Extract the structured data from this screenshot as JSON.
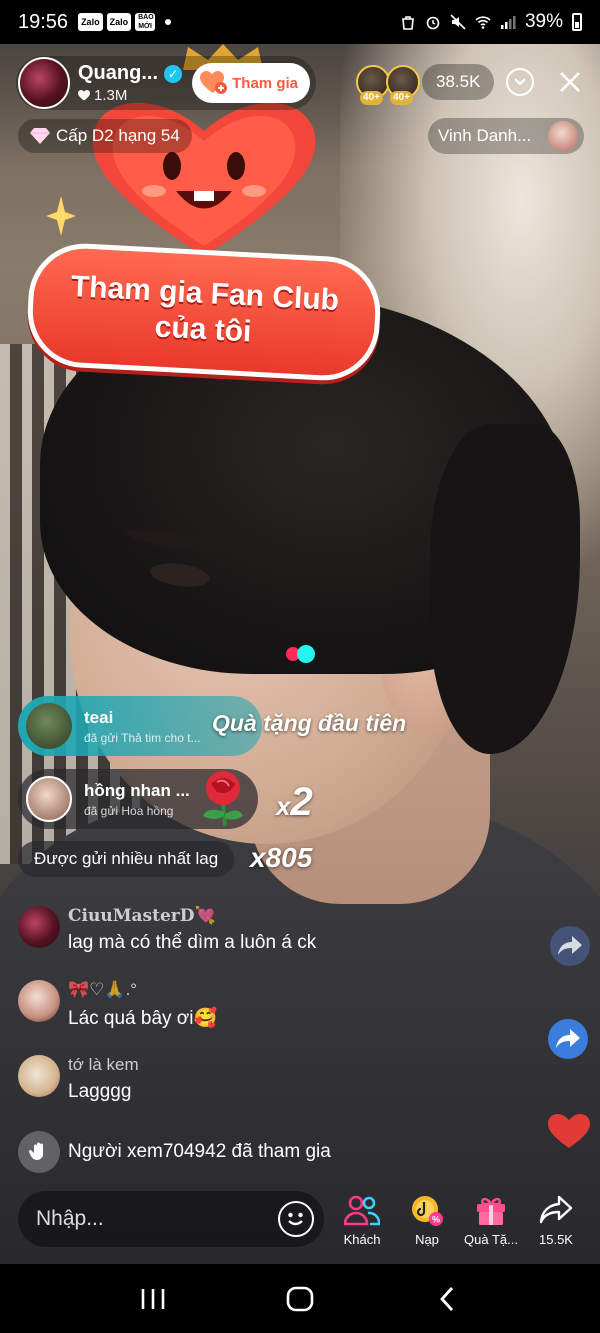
{
  "status_bar": {
    "time": "19:56",
    "notification_badges": [
      "Zalo",
      "Zalo",
      "BÁO MỚI"
    ],
    "battery": "39%"
  },
  "host": {
    "name": "Quang...",
    "likes": "1.3M",
    "join_label": "Tham gia"
  },
  "viewers": {
    "badge_levels": [
      "40+",
      "40+"
    ],
    "count": "38.5K"
  },
  "rank": {
    "label": "Cấp D2 hạng 54"
  },
  "honor": {
    "label": "Vinh Danh..."
  },
  "fan_club": {
    "line1": "Tham gia Fan Club",
    "line2": "của tôi"
  },
  "gifts": [
    {
      "user": "teai",
      "desc": "đã gửi Thả tim cho t...",
      "effect_text": "Quà tặng đầu tiên"
    },
    {
      "user": "hồng nhan ...",
      "desc": "đã gửi Hoa hồng",
      "combo_prefix": "x",
      "combo_count": "2"
    }
  ],
  "most_sent": {
    "label": "Được gửi nhiều nhất lag",
    "count": "x805"
  },
  "chat": [
    {
      "user": "CiuuMasterD💘",
      "message": "lag mà có thể dìm a luôn á ck"
    },
    {
      "user": "🎀♡🙏.°",
      "message": "Lác quá bây ơi🥰"
    },
    {
      "user": "tớ là kem",
      "message": "Lagggg"
    }
  ],
  "join_notice": "Người xem704942 đã tham gia",
  "comment_input": {
    "placeholder": "Nhập..."
  },
  "bottom_actions": [
    {
      "label": "Khách"
    },
    {
      "label": "Nạp"
    },
    {
      "label": "Quà Tặ..."
    },
    {
      "label": "15.5K"
    }
  ],
  "colors": {
    "accent_red": "#e9392b",
    "verified_blue": "#20c5f4",
    "teal_banner": "#1fa7b3",
    "like_red": "#e23a36"
  }
}
